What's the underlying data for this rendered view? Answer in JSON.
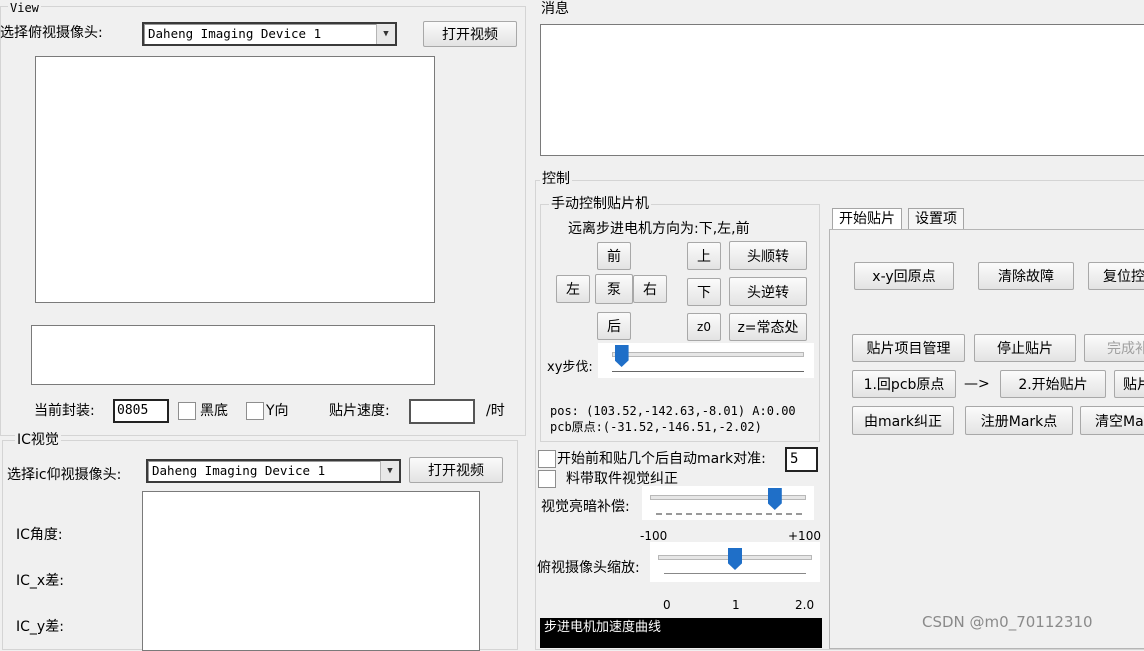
{
  "view": {
    "title": "View",
    "top_camera_label": "选择俯视摄像头:",
    "top_camera_value": "Daheng Imaging Device 1",
    "open_video": "打开视频",
    "package_label": "当前封装:",
    "package_value": "0805",
    "black_bg_label": "黑底",
    "y_dir_label": "Y向",
    "speed_label": "贴片速度:",
    "speed_unit": "/时"
  },
  "ic": {
    "title": "IC视觉",
    "camera_label": "选择ic仰视摄像头:",
    "camera_value": "Daheng Imaging Device 1",
    "open_video": "打开视频",
    "angle_label": "IC角度:",
    "x_label": "IC_x差:",
    "y_label": "IC_y差:"
  },
  "messages": {
    "title": "消息"
  },
  "control": {
    "title": "控制",
    "manual": {
      "title": "手动控制贴片机",
      "hint": "远离步进电机方向为:下,左,前",
      "front": "前",
      "left": "左",
      "pump": "泵",
      "right": "右",
      "back": "后",
      "up": "上",
      "down": "下",
      "z0": "z0",
      "head_cw": "头顺转",
      "head_ccw": "头逆转",
      "z_normal": "z=常态处",
      "xy_step": "xy步伐:",
      "xy_step_level": 0.05,
      "pos": "pos: (103.52,-142.63,-8.01) A:0.00",
      "pcb_origin": "pcb原点:(-31.52,-146.51,-2.02)"
    },
    "auto_mark_label": "开始前和贴几个后自动mark对准:",
    "auto_mark_value": "5",
    "feeder_correct_label": "料带取件视觉纠正",
    "brightness": {
      "label": "视觉亮暗补偿:",
      "min": "-100",
      "max": "+100",
      "value": 60
    },
    "zoom": {
      "label": "俯视摄像头缩放:",
      "ticks": [
        "0",
        "1",
        "2.0"
      ],
      "value": 1.0
    },
    "curve_title": "步进电机加速度曲线"
  },
  "tabs": {
    "start": "开始贴片",
    "settings": "设置项"
  },
  "buttons": {
    "xy_home": "x-y回原点",
    "clear_fault": "清除故障",
    "reset": "复位控",
    "project_mgmt": "贴片项目管理",
    "stop": "停止贴片",
    "complete": "完成补",
    "step1": "1.回pcb原点",
    "arrow": "—>",
    "step2": "2.开始贴片",
    "step3": "贴片",
    "mark_correct": "由mark纠正",
    "register_mark": "注册Mark点",
    "clear_mark": "清空Mar"
  },
  "watermark": "CSDN @m0_70112310"
}
